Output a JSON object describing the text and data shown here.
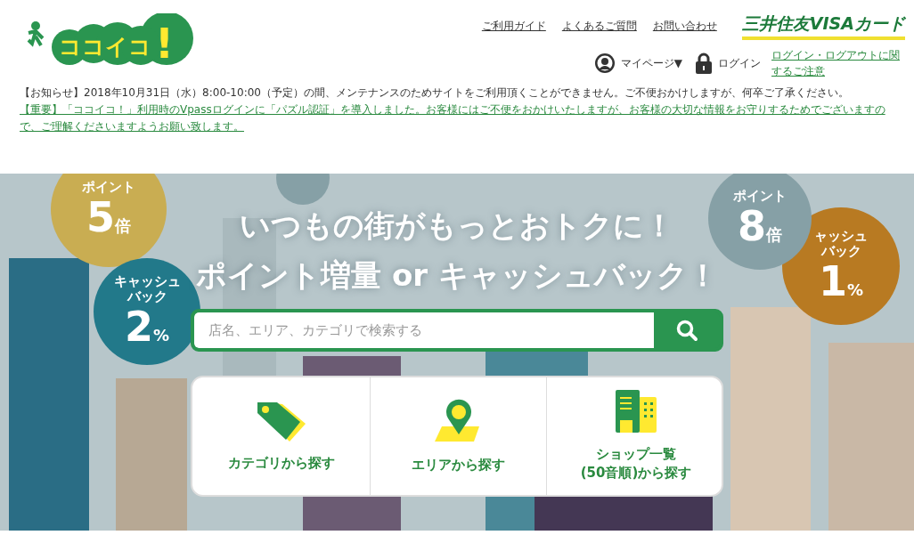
{
  "header": {
    "logo": {
      "text": "ココイコ",
      "mark": "!"
    },
    "links": [
      "ご利用ガイド",
      "よくあるご質問",
      "お問い合わせ"
    ],
    "brand": "三井住友VISAカード",
    "mypage": "マイページ▼",
    "login": "ログイン",
    "login_notice": "ログイン・ログアウトに関するご注意"
  },
  "notices": [
    {
      "kind": "plain",
      "text": "【お知らせ】2018年10月31日（水）8:00-10:00（予定）の間、メンテナンスのためサイトをご利用頂くことができません。ご不便おかけしますが、何卒ご了承ください。"
    },
    {
      "kind": "link",
      "text": "【重要】「ココイコ！」利用時のVpassログインに「パズル認証」を導入しました。お客様にはご不便をおかけいたしますが、お客様の大切な情報をお守りするためでございますので、ご理解くださいますようお願い致します。"
    }
  ],
  "hero": {
    "title_lines": [
      "いつもの街がもっとおトクに！",
      "ポイント増量 or キャッシュバック！"
    ],
    "bubbles": [
      {
        "label": [
          "ポイント"
        ],
        "number": "5",
        "unit": "倍",
        "color": "#c9ad52"
      },
      {
        "label": [
          "キャッシュ",
          "バック"
        ],
        "number": "2",
        "unit": "%",
        "color": "#22798a"
      },
      {
        "label": [
          "ャッシュ",
          "バック"
        ],
        "number": "1",
        "unit": "%",
        "color": "#b87a22"
      },
      {
        "label": [
          "ポイント"
        ],
        "number": "8",
        "unit": "倍",
        "color": "#86a0a6"
      }
    ],
    "search": {
      "placeholder": "店名、エリア、カテゴリで検索する"
    },
    "cards": [
      {
        "kind": "tag",
        "label": "カテゴリから探す"
      },
      {
        "kind": "pin",
        "label": "エリアから探す"
      },
      {
        "kind": "building",
        "label": "ショップ一覧\n(50音順)から探す"
      }
    ]
  }
}
